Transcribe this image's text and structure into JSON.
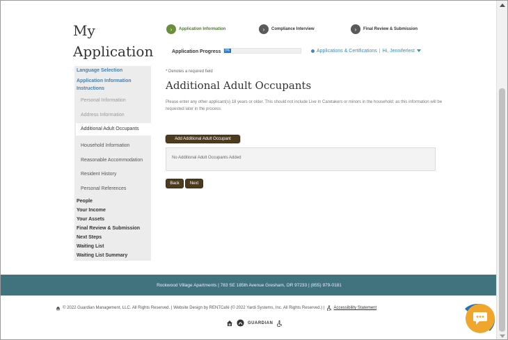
{
  "page": {
    "title": "My Application"
  },
  "steps": [
    {
      "label": "Application Information",
      "state": "current",
      "icon": "chevron-right-icon"
    },
    {
      "label": "Compliance Interview",
      "state": "upcoming",
      "icon": "chevron-right-icon"
    },
    {
      "label": "Final Review & Submission",
      "state": "upcoming",
      "icon": "chevron-right-icon"
    }
  ],
  "progress": {
    "label": "Application Progress",
    "value_text": "0%",
    "value": 0
  },
  "account": {
    "apps_link": "Applications & Certifications",
    "greeting": "Hi, Jenniferlest"
  },
  "sidebar": {
    "sections": [
      {
        "label": "Language Selection"
      },
      {
        "label": "Application Information Instructions"
      },
      {
        "label": "People"
      },
      {
        "label": "Your Income"
      },
      {
        "label": "Your Assets"
      },
      {
        "label": "Final Review & Submission"
      },
      {
        "label": "Next Steps"
      },
      {
        "label": "Waiting List"
      },
      {
        "label": "Waiting List Summary"
      }
    ],
    "sub_items": [
      {
        "label": "Personal Information"
      },
      {
        "label": "Address Information"
      },
      {
        "label": "Additional Adult Occupants"
      },
      {
        "label": "Household Information"
      },
      {
        "label": "Reasonable Accommodation"
      },
      {
        "label": "Resident History"
      },
      {
        "label": "Personal References"
      }
    ]
  },
  "main": {
    "required_note": "* Denotes a required field",
    "heading": "Additional Adult Occupants",
    "description": "Please enter any other applicant(s) 18 years or older. This should not include Live In Caretakers or minors in the household; as this information will be requested later in the process.",
    "add_button": "Add Additional Adult Occupant",
    "empty_text": "No Additional Adult Occupants Added",
    "back_button": "Back",
    "next_button": "Next"
  },
  "footer": {
    "address": "Rockwood Village Apartments  |  783 SE 185th Avenue  Gresham, OR 97233  |  (855) 979-0181",
    "copyright": "© 2022 Guardian Management, LLC. All Rights Reserved. | Website Design by RENTCafé (© 2022 Yardi Systems, Inc. All Rights Reserved.) |",
    "accessibility_link": "Accessibility Statement",
    "logo_text": "GUARDIAN"
  },
  "colors": {
    "accent_blue": "#1e73be",
    "footer_teal": "#41737f",
    "button_brown": "#4d3b20",
    "step_active_green": "#6a8f3a",
    "chat_orange": "#f0a52c"
  }
}
